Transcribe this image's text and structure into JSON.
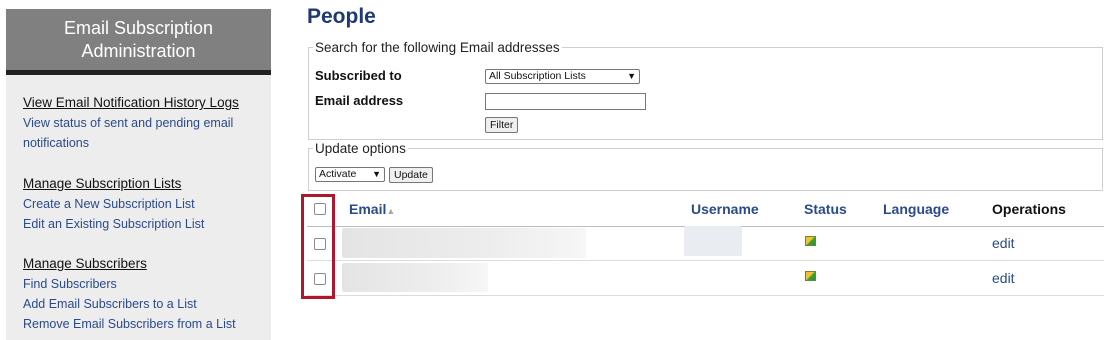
{
  "sidebar": {
    "title": "Email Subscription Administration",
    "sections": [
      {
        "heading": "View Email Notification History Logs",
        "links": [
          "View status of sent and pending email notifications"
        ]
      },
      {
        "heading": "Manage Subscription Lists",
        "links": [
          "Create a New Subscription List",
          "Edit an Existing Subscription List"
        ]
      },
      {
        "heading": "Manage Subscribers",
        "links": [
          "Find Subscribers",
          "Add Email Subscribers to a List",
          "Remove Email Subscribers from a List"
        ]
      }
    ]
  },
  "main": {
    "title": "People",
    "search": {
      "legend": "Search for the following Email addresses",
      "subscribed_to_label": "Subscribed to",
      "subscribed_to_value": "All Subscription Lists",
      "email_label": "Email address",
      "email_value": "",
      "filter_button": "Filter"
    },
    "update": {
      "legend": "Update options",
      "action_value": "Activate",
      "update_button": "Update"
    },
    "table": {
      "columns": [
        "Email",
        "Username",
        "Status",
        "Language",
        "Operations"
      ],
      "sort_indicator": "▲",
      "rows": [
        {
          "status_icon": "active-status-icon",
          "operation": "edit"
        },
        {
          "status_icon": "active-status-icon",
          "operation": "edit"
        }
      ]
    }
  },
  "colors": {
    "sidebar_header": "#808080",
    "title": "#1f3a73",
    "link": "#2a4a8a",
    "highlight": "#b0172f"
  }
}
